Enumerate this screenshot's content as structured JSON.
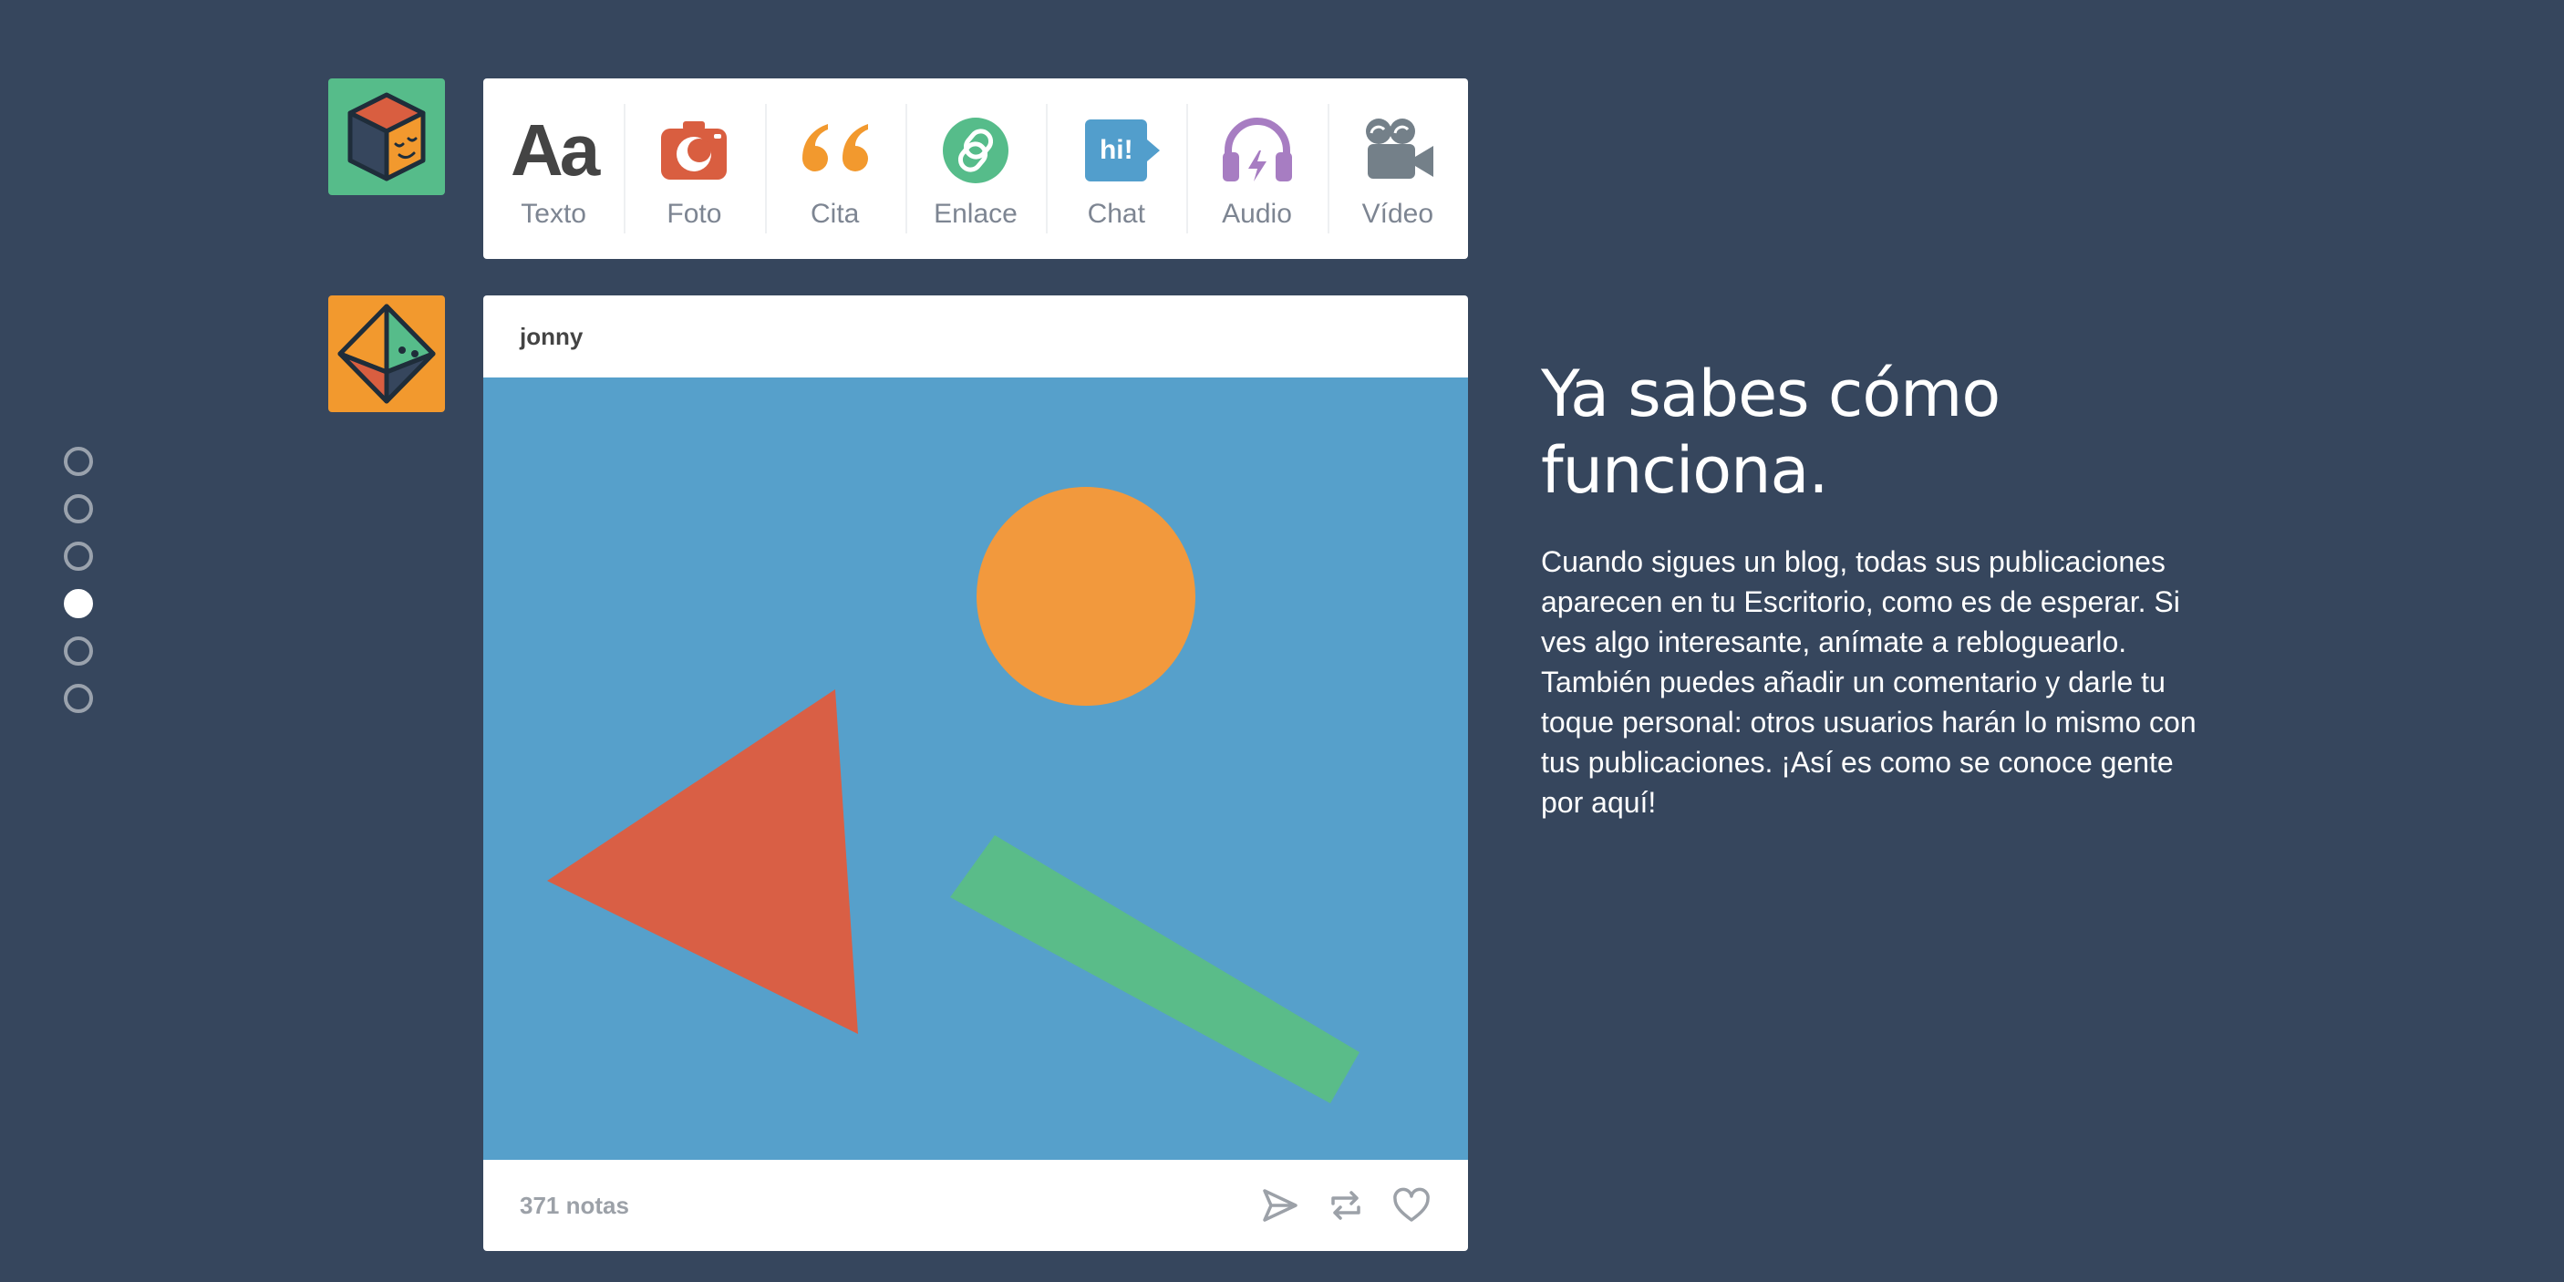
{
  "pager": {
    "count": 6,
    "active_index": 3
  },
  "post_types": [
    {
      "label": "Texto",
      "glyph": "Aa",
      "icon": "text-icon",
      "color": "#444444"
    },
    {
      "label": "Foto",
      "icon": "camera-icon",
      "color": "#d95e40"
    },
    {
      "label": "Cita",
      "icon": "quote-icon",
      "color": "#f2992e"
    },
    {
      "label": "Enlace",
      "icon": "link-icon",
      "color": "#56bc8a"
    },
    {
      "label": "Chat",
      "glyph": "hi!",
      "icon": "chat-icon",
      "color": "#529ecc"
    },
    {
      "label": "Audio",
      "icon": "headphones-icon",
      "color": "#a77dc2"
    },
    {
      "label": "Vídeo",
      "icon": "video-camera-icon",
      "color": "#748089"
    }
  ],
  "post": {
    "blog_name": "jonny",
    "notes": "371 notas",
    "media_background": "#56a0cb",
    "actions": [
      "share-icon",
      "reblog-icon",
      "like-icon"
    ]
  },
  "copy": {
    "heading": "Ya sabes cómo funciona.",
    "body": "Cuando sigues un blog, todas sus publicaciones aparecen en tu Escritorio, como es de esperar. Si ves algo interesante, anímate a rebloguearlo. También puedes añadir un comentario y darle tu toque personal: otros usuarios harán lo mismo con tus publicaciones. ¡Así es como se conoce gente por aquí!"
  },
  "colors": {
    "background": "#36465d",
    "avatar_top": "#56bc8a",
    "avatar_post": "#f2992e"
  }
}
